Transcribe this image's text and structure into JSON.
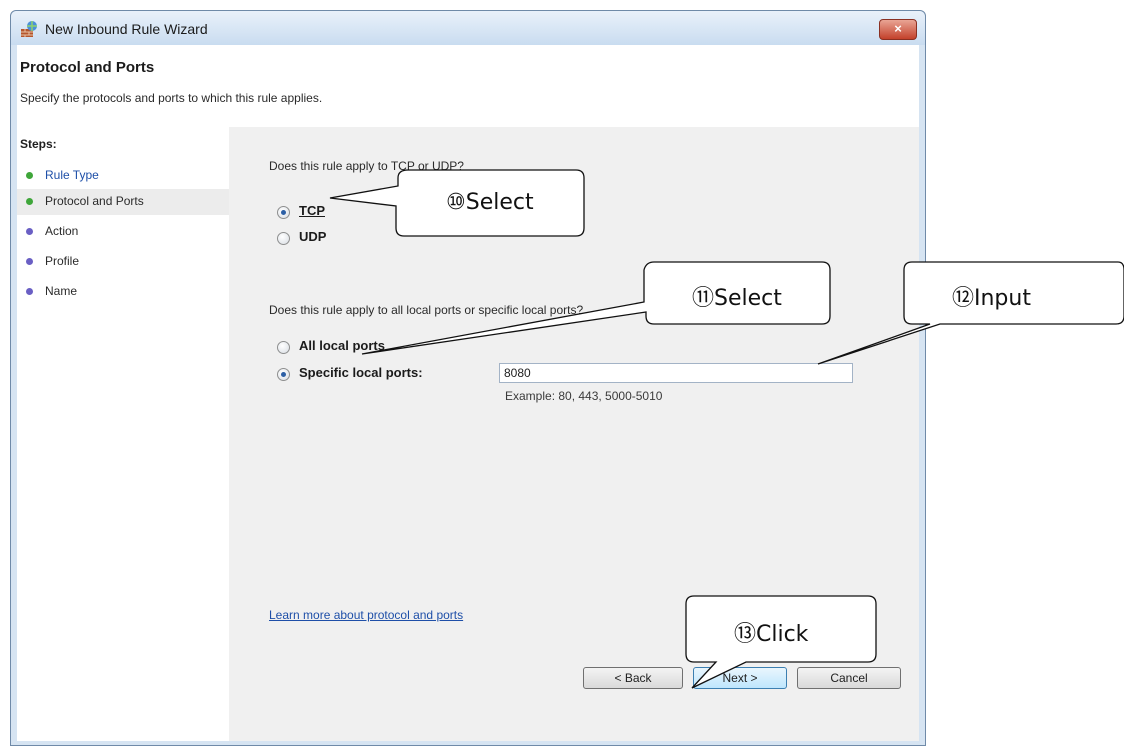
{
  "window": {
    "title": "New Inbound Rule Wizard",
    "close_label": "×"
  },
  "header": {
    "title": "Protocol and Ports",
    "subtitle": "Specify the protocols and ports to which this rule applies."
  },
  "steps": {
    "heading": "Steps:",
    "items": [
      {
        "label": "Rule Type",
        "dot_color": "#3fa63a"
      },
      {
        "label": "Protocol and Ports",
        "dot_color": "#3fa63a"
      },
      {
        "label": "Action",
        "dot_color": "#6a5fc4"
      },
      {
        "label": "Profile",
        "dot_color": "#6a5fc4"
      },
      {
        "label": "Name",
        "dot_color": "#6a5fc4"
      }
    ]
  },
  "protocol": {
    "question": "Does this rule apply to TCP or UDP?",
    "tcp_label": "TCP",
    "udp_label": "UDP",
    "selected": "TCP"
  },
  "ports": {
    "question": "Does this rule apply to all local ports or specific local ports?",
    "all_label": "All local ports",
    "specific_label": "Specific local ports:",
    "selected": "Specific local ports",
    "value": "8080",
    "example": "Example: 80, 443, 5000-5010"
  },
  "learn_more": "Learn more about protocol and ports",
  "buttons": {
    "back": "< Back",
    "next": "Next >",
    "cancel": "Cancel"
  },
  "callouts": {
    "c10": "⑩Select",
    "c11": "⑪Select",
    "c12": "⑫Input",
    "c13": "⑬Click"
  },
  "colors": {
    "link": "#1e4fa8",
    "accent": "#3c7fb1"
  }
}
